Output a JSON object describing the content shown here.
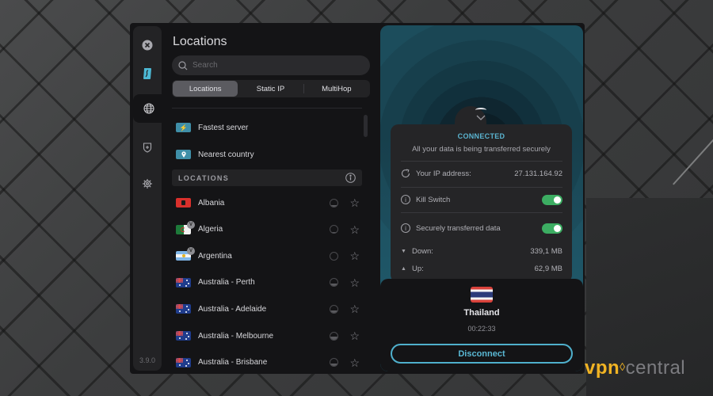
{
  "app": {
    "version": "3.9.0",
    "rail": [
      {
        "name": "close",
        "icon": "close-icon"
      },
      {
        "name": "brand",
        "icon": "surfshark-logo-icon"
      },
      {
        "name": "locations",
        "icon": "globe-icon",
        "active": true
      },
      {
        "name": "vpn-protection",
        "icon": "shield-plus-icon"
      },
      {
        "name": "settings",
        "icon": "gear-icon"
      }
    ]
  },
  "locations_panel": {
    "title": "Locations",
    "search_placeholder": "Search",
    "search_value": "",
    "tabs": [
      {
        "label": "Locations",
        "active": true
      },
      {
        "label": "Static IP",
        "active": false
      },
      {
        "label": "MultiHop",
        "active": false
      }
    ],
    "quick_connect": [
      {
        "label": "Fastest server",
        "icon": "lightning-icon"
      },
      {
        "label": "Nearest country",
        "icon": "location-pin-icon"
      }
    ],
    "section_header": "LOCATIONS",
    "items": [
      {
        "name": "Albania",
        "flag": "albania",
        "virtual": false,
        "load": 0.2
      },
      {
        "name": "Algeria",
        "flag": "algeria",
        "virtual": true,
        "load": 0.15
      },
      {
        "name": "Argentina",
        "flag": "argentina",
        "virtual": true,
        "load": 0.0
      },
      {
        "name": "Australia - Perth",
        "flag": "australia",
        "virtual": false,
        "load": 0.4
      },
      {
        "name": "Australia - Adelaide",
        "flag": "australia",
        "virtual": false,
        "load": 0.35
      },
      {
        "name": "Australia - Melbourne",
        "flag": "australia",
        "virtual": false,
        "load": 0.35
      },
      {
        "name": "Australia - Brisbane",
        "flag": "australia",
        "virtual": false,
        "load": 0.35
      }
    ]
  },
  "status_panel": {
    "status": "CONNECTED",
    "subtitle": "All your data is being transferred securely",
    "ip_label": "Your IP address:",
    "ip_value": "27.131.164.92",
    "kill_switch_label": "Kill Switch",
    "kill_switch_on": true,
    "secure_data_label": "Securely transferred data",
    "secure_data_on": true,
    "down_label": "Down:",
    "down_value": "339,1 MB",
    "up_label": "Up:",
    "up_value": "62,9 MB",
    "country": "Thailand",
    "timer": "00:22:33",
    "disconnect_label": "Disconnect"
  },
  "watermark": {
    "part1": "vpn",
    "part2": "central"
  },
  "colors": {
    "accent": "#5ab4d0",
    "toggle_on": "#3cad62",
    "quick_icon_bg": "#3f8fa8",
    "watermark_yellow": "#f0b323"
  }
}
